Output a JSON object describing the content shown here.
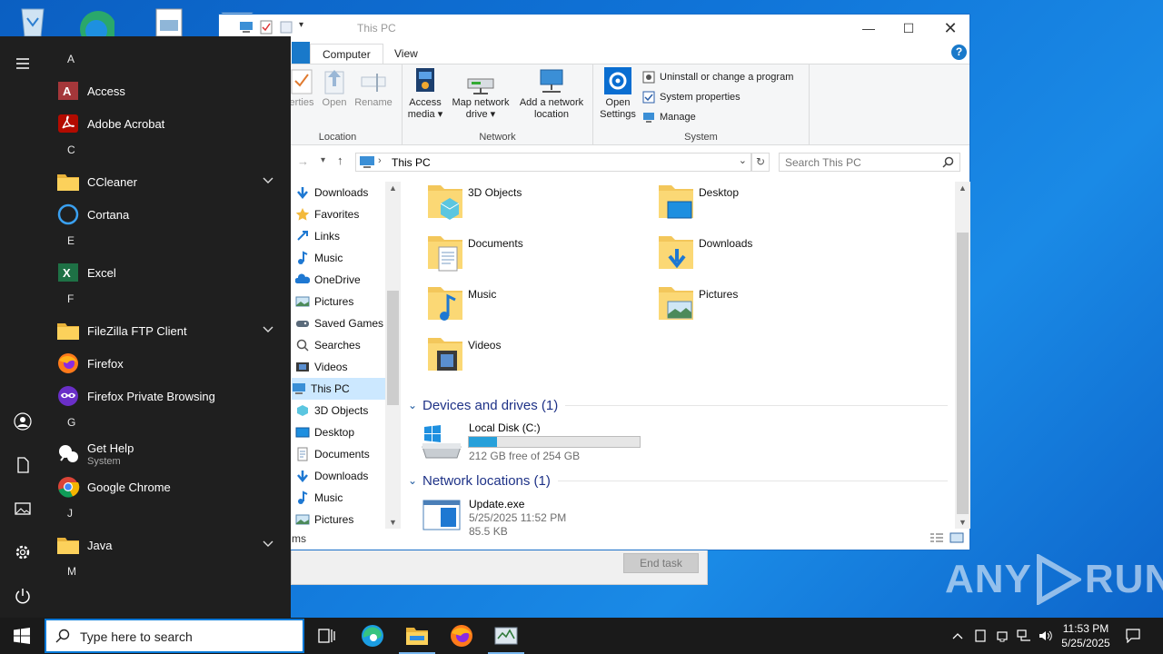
{
  "explorer": {
    "title": "This PC",
    "tabs": [
      "Computer",
      "View"
    ],
    "ribbon": {
      "location_group": {
        "label": "Location",
        "buttons": [
          "erties",
          "Open",
          "Rename"
        ]
      },
      "network_group": {
        "label": "Network",
        "buttons": [
          {
            "line1": "Access",
            "line2": "media ▾"
          },
          {
            "line1": "Map network",
            "line2": "drive ▾"
          },
          {
            "line1": "Add a network",
            "line2": "location"
          }
        ]
      },
      "system_group": {
        "label": "System",
        "open_settings": {
          "line1": "Open",
          "line2": "Settings"
        },
        "items": [
          "Uninstall or change a program",
          "System properties",
          "Manage"
        ]
      }
    },
    "address": "This PC",
    "search_placeholder": "Search This PC",
    "nav_items": [
      "Downloads",
      "Favorites",
      "Links",
      "Music",
      "OneDrive",
      "Pictures",
      "Saved Games",
      "Searches",
      "Videos",
      "This PC",
      "3D Objects",
      "Desktop",
      "Documents",
      "Downloads",
      "Music",
      "Pictures"
    ],
    "folders": [
      "3D Objects",
      "Desktop",
      "Documents",
      "Downloads",
      "Music",
      "Pictures",
      "Videos"
    ],
    "devices_section": "Devices and drives (1)",
    "drive": {
      "name": "Local Disk (C:)",
      "free": "212 GB free of 254 GB",
      "used_fraction": 0.165
    },
    "network_section": "Network locations (1)",
    "network_item": {
      "name": "Update.exe",
      "date": "5/25/2025 11:52 PM",
      "size": "85.5 KB"
    },
    "status": "ms"
  },
  "taskmgr": {
    "end_task": "End task"
  },
  "startmenu": {
    "groups": [
      {
        "letter": "A",
        "apps": [
          {
            "name": "Access"
          },
          {
            "name": "Adobe Acrobat"
          }
        ]
      },
      {
        "letter": "C",
        "apps": [
          {
            "name": "CCleaner"
          },
          {
            "name": "Cortana"
          }
        ]
      },
      {
        "letter": "E",
        "apps": [
          {
            "name": "Excel"
          }
        ]
      },
      {
        "letter": "F",
        "apps": [
          {
            "name": "FileZilla FTP Client"
          },
          {
            "name": "Firefox"
          },
          {
            "name": "Firefox Private Browsing"
          }
        ]
      },
      {
        "letter": "G",
        "apps": [
          {
            "name": "Get Help",
            "sub": "System"
          },
          {
            "name": "Google Chrome"
          }
        ]
      },
      {
        "letter": "J",
        "apps": [
          {
            "name": "Java"
          }
        ]
      },
      {
        "letter": "M",
        "apps": []
      }
    ]
  },
  "taskbar": {
    "search_placeholder": "Type here to search",
    "time": "11:53 PM",
    "date": "5/25/2025"
  },
  "watermark": "ANY RUN",
  "colors": {
    "accent": "#0078d7",
    "desktop": "#0b5fc2",
    "start_bg": "#1f1f1f",
    "taskbar_bg": "#1a1a1a"
  }
}
